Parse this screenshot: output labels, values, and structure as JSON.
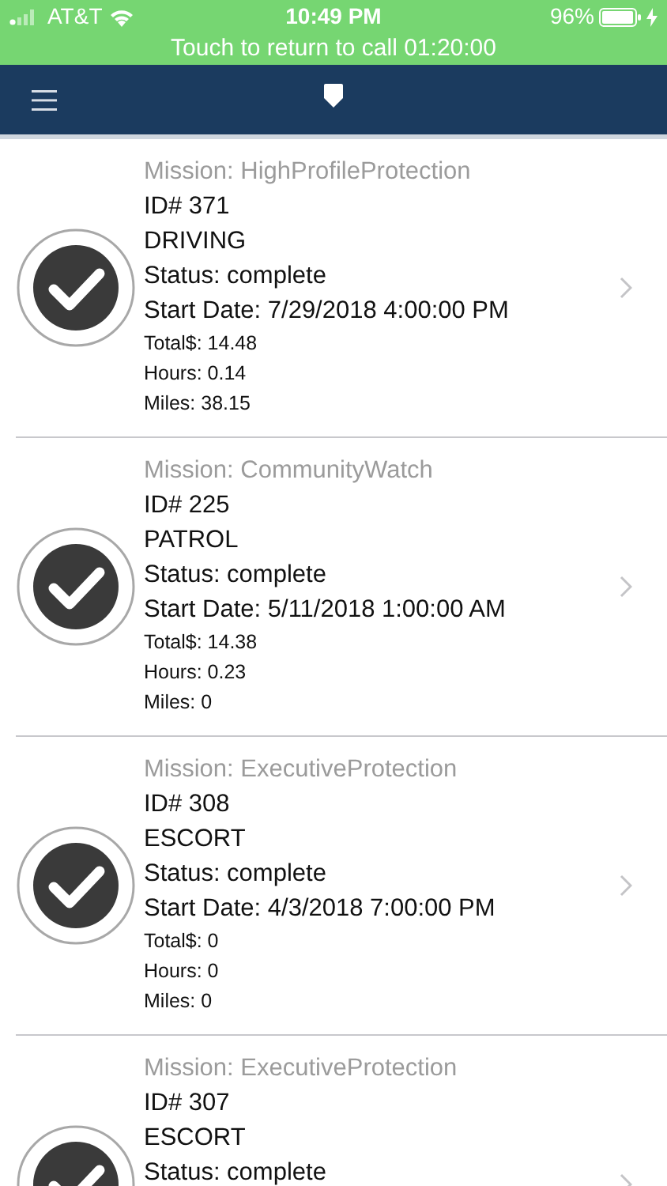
{
  "status_bar": {
    "carrier": "AT&T",
    "time": "10:49 PM",
    "battery": "96%",
    "charging": true
  },
  "call_banner": {
    "text": "Touch to return to call 01:20:00"
  },
  "missions": [
    {
      "mission": "Mission: HighProfileProtection",
      "id": "ID# 371",
      "type": "DRIVING",
      "status": "Status: complete",
      "start": "Start Date: 7/29/2018 4:00:00 PM",
      "total": "Total$: 14.48",
      "hours": "Hours: 0.14",
      "miles": "Miles: 38.15",
      "completed": true
    },
    {
      "mission": "Mission: CommunityWatch",
      "id": "ID# 225",
      "type": "PATROL",
      "status": "Status: complete",
      "start": "Start Date: 5/11/2018 1:00:00 AM",
      "total": "Total$: 14.38",
      "hours": "Hours: 0.23",
      "miles": "Miles: 0",
      "completed": true
    },
    {
      "mission": "Mission: ExecutiveProtection",
      "id": "ID# 308",
      "type": "ESCORT",
      "status": "Status: complete",
      "start": "Start Date: 4/3/2018 7:00:00 PM",
      "total": "Total$: 0",
      "hours": "Hours: 0",
      "miles": "Miles: 0",
      "completed": true
    },
    {
      "mission": "Mission: ExecutiveProtection",
      "id": "ID# 307",
      "type": "ESCORT",
      "status": "Status: complete",
      "completed": true
    }
  ]
}
